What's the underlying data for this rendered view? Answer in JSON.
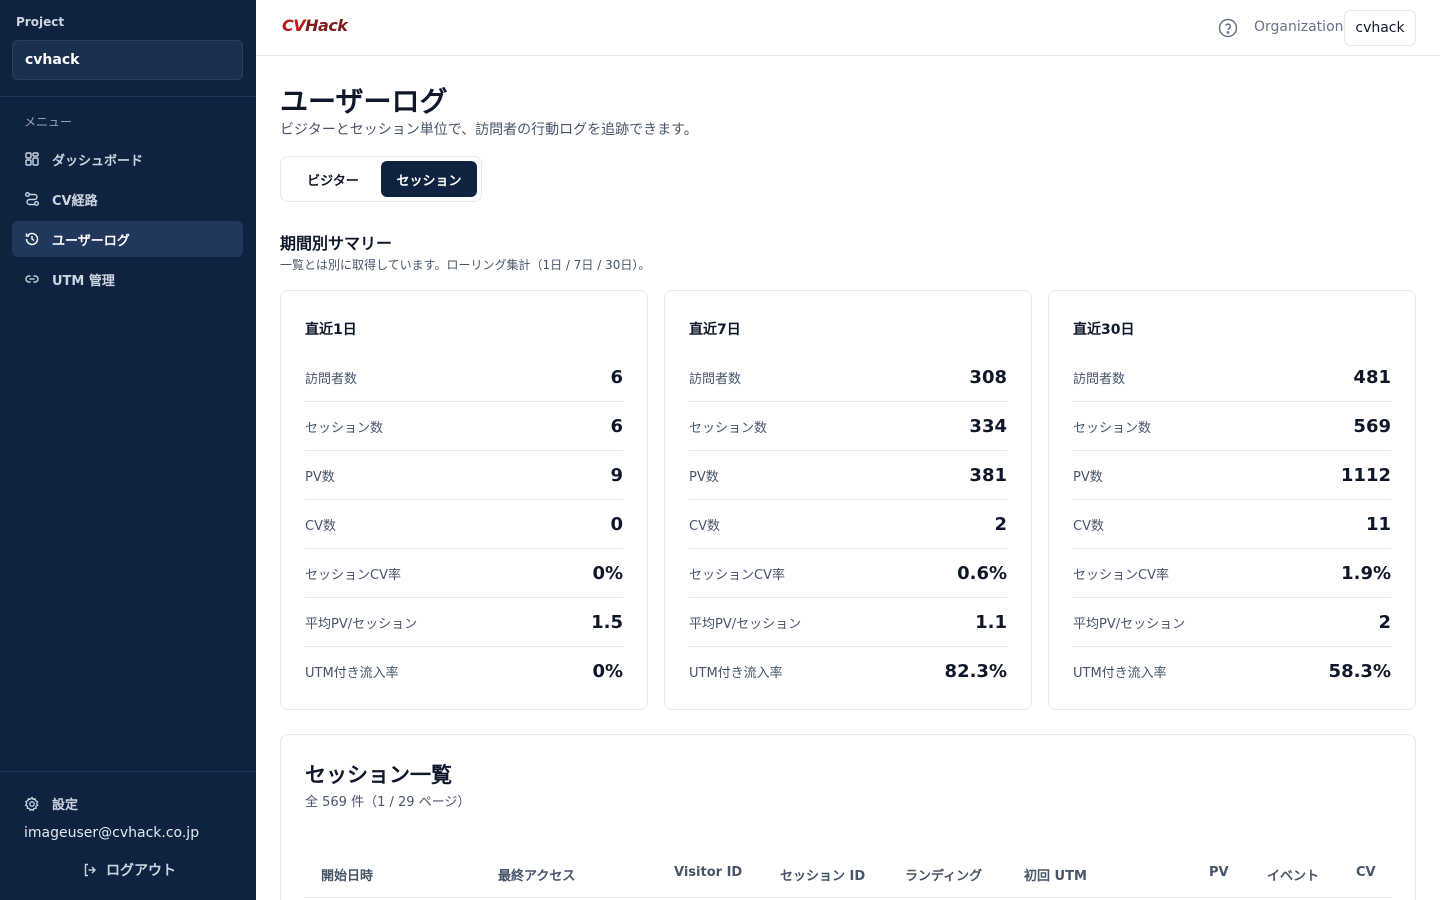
{
  "sidebar": {
    "project_label": "Project",
    "project_value": "cvhack",
    "menu_label": "メニュー",
    "items": [
      {
        "label": "ダッシュボード",
        "icon": "grid-icon"
      },
      {
        "label": "CV経路",
        "icon": "route-icon"
      },
      {
        "label": "ユーザーログ",
        "icon": "history-icon",
        "active": true
      },
      {
        "label": "UTM 管理",
        "icon": "link-icon"
      }
    ],
    "settings_label": "設定",
    "email": "imageuser@cvhack.co.jp",
    "logout_label": "ログアウト"
  },
  "header": {
    "logo_cv": "CV",
    "logo_hack": "Hack",
    "org_label": "Organization",
    "org_value": "cvhack"
  },
  "page": {
    "title": "ユーザーログ",
    "subtitle": "ビジターとセッション単位で、訪問者の行動ログを追跡できます。",
    "tabs": [
      "ビジター",
      "セッション"
    ],
    "active_tab": "セッション"
  },
  "summary": {
    "title": "期間別サマリー",
    "subtitle": "一覧とは別に取得しています。ローリング集計（1日 / 7日 / 30日）。",
    "cards": [
      {
        "title": "直近1日",
        "metrics": [
          {
            "label": "訪問者数",
            "value": "6"
          },
          {
            "label": "セッション数",
            "value": "6"
          },
          {
            "label": "PV数",
            "value": "9"
          },
          {
            "label": "CV数",
            "value": "0"
          },
          {
            "label": "セッションCV率",
            "value": "0%"
          },
          {
            "label": "平均PV/セッション",
            "value": "1.5"
          },
          {
            "label": "UTM付き流入率",
            "value": "0%"
          }
        ]
      },
      {
        "title": "直近7日",
        "metrics": [
          {
            "label": "訪問者数",
            "value": "308"
          },
          {
            "label": "セッション数",
            "value": "334"
          },
          {
            "label": "PV数",
            "value": "381"
          },
          {
            "label": "CV数",
            "value": "2"
          },
          {
            "label": "セッションCV率",
            "value": "0.6%"
          },
          {
            "label": "平均PV/セッション",
            "value": "1.1"
          },
          {
            "label": "UTM付き流入率",
            "value": "82.3%"
          }
        ]
      },
      {
        "title": "直近30日",
        "metrics": [
          {
            "label": "訪問者数",
            "value": "481"
          },
          {
            "label": "セッション数",
            "value": "569"
          },
          {
            "label": "PV数",
            "value": "1112"
          },
          {
            "label": "CV数",
            "value": "11"
          },
          {
            "label": "セッションCV率",
            "value": "1.9%"
          },
          {
            "label": "平均PV/セッション",
            "value": "2"
          },
          {
            "label": "UTM付き流入率",
            "value": "58.3%"
          }
        ]
      }
    ]
  },
  "session_list": {
    "title": "セッション一覧",
    "subtitle": "全 569 件（1 / 29 ページ）",
    "columns": [
      "開始日時",
      "最終アクセス",
      "Visitor ID",
      "セッション ID",
      "ランディング",
      "初回 UTM",
      "PV",
      "イベント",
      "CV"
    ]
  }
}
